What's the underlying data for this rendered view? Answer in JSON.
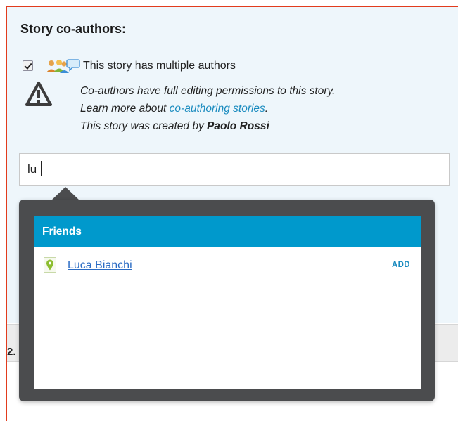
{
  "section": {
    "title": "Story co-authors:"
  },
  "multiple_authors": {
    "checked": true,
    "label": "This story has multiple authors"
  },
  "info": {
    "line1": "Co-authors have full editing permissions to this story.",
    "line2_prefix": "Learn more about",
    "line2_link": "co-authoring stories",
    "line2_suffix": ".",
    "line3_prefix": "This story was created by",
    "creator": "Paolo Rossi"
  },
  "search": {
    "value": "lu"
  },
  "suggestions": {
    "group_label": "Friends",
    "results": [
      {
        "name": "Luca Bianchi",
        "action": "ADD"
      }
    ]
  },
  "background_fragment": "2.",
  "icons": {
    "checkbox": "checkbox-checked-icon",
    "people": "co-authors-people-icon",
    "warning": "warning-triangle-icon",
    "location": "location-pin-icon"
  },
  "colors": {
    "accent": "#0099cc",
    "link": "#1a8bbf",
    "dropdown_frame": "#4b4c4e",
    "panel_border": "#e23b1d",
    "pin": "#8dbe2f"
  }
}
